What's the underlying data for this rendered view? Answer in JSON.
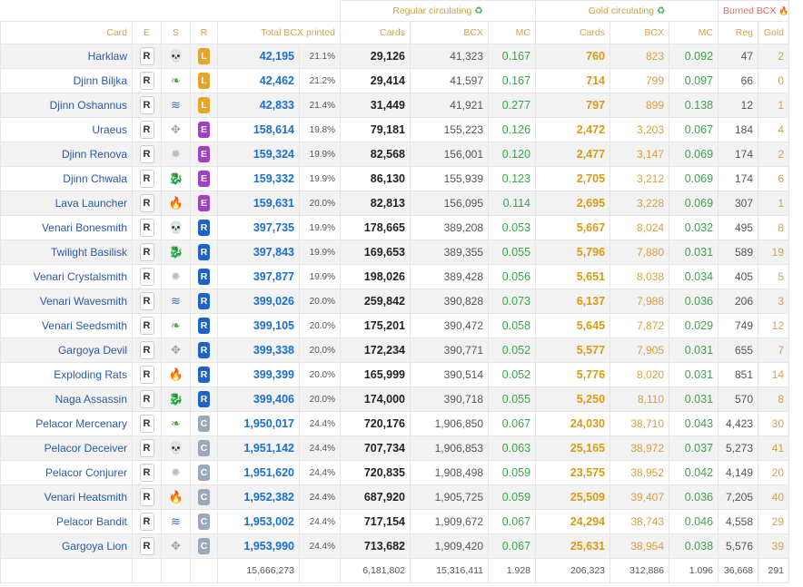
{
  "headers": {
    "group_regular": "Regular circulating",
    "group_gold": "Gold circulating",
    "group_burned": "Burned BCX",
    "col_card": "Card",
    "col_e": "E",
    "col_s": "S",
    "col_r": "R",
    "col_total": "Total BCX printed",
    "col_reg_cards": "Cards",
    "col_reg_bcx": "BCX",
    "col_reg_mc": "MC",
    "col_gold_cards": "Cards",
    "col_gold_bcx": "BCX",
    "col_gold_mc": "MC",
    "col_burn_reg": "Reg",
    "col_burn_gold": "Gold"
  },
  "icons": {
    "recycle": "♻",
    "fire": "🔥"
  },
  "colors": {
    "legendary": "#e5a52a",
    "epic": "#a23fc4",
    "rare": "#1e64c8",
    "common": "#9aa8b8",
    "death": "#8a2fa0",
    "earth": "#4ea63a",
    "water": "#3b6fc7",
    "neutral": "#9aa3ad",
    "life": "#bfbfbf",
    "dragon": "#e2a41c",
    "fire": "#d8331f"
  },
  "element_glyphs": {
    "death": "💀",
    "earth": "❧",
    "water": "≋",
    "neutral": "✥",
    "life": "✹",
    "dragon": "🐉",
    "fire": "🔥"
  },
  "rows": [
    {
      "card": "Harklaw",
      "edition": "R",
      "element": "death",
      "rarity": "L",
      "total": "42,195",
      "pct": "21.1%",
      "reg_cards": "29,126",
      "reg_bcx": "41,323",
      "reg_mc": "0.167",
      "gold_cards": "760",
      "gold_bcx": "823",
      "gold_mc": "0.092",
      "burn_reg": "47",
      "burn_gold": "2"
    },
    {
      "card": "Djinn Biljka",
      "edition": "R",
      "element": "earth",
      "rarity": "L",
      "total": "42,462",
      "pct": "21.2%",
      "reg_cards": "29,414",
      "reg_bcx": "41,597",
      "reg_mc": "0.167",
      "gold_cards": "714",
      "gold_bcx": "799",
      "gold_mc": "0.097",
      "burn_reg": "66",
      "burn_gold": "0"
    },
    {
      "card": "Djinn Oshannus",
      "edition": "R",
      "element": "water",
      "rarity": "L",
      "total": "42,833",
      "pct": "21.4%",
      "reg_cards": "31,449",
      "reg_bcx": "41,921",
      "reg_mc": "0.277",
      "gold_cards": "797",
      "gold_bcx": "899",
      "gold_mc": "0.138",
      "burn_reg": "12",
      "burn_gold": "1"
    },
    {
      "card": "Uraeus",
      "edition": "R",
      "element": "neutral",
      "rarity": "E",
      "total": "158,614",
      "pct": "19.8%",
      "reg_cards": "79,181",
      "reg_bcx": "155,223",
      "reg_mc": "0.126",
      "gold_cards": "2,472",
      "gold_bcx": "3,203",
      "gold_mc": "0.067",
      "burn_reg": "184",
      "burn_gold": "4"
    },
    {
      "card": "Djinn Renova",
      "edition": "R",
      "element": "life",
      "rarity": "E",
      "total": "159,324",
      "pct": "19.9%",
      "reg_cards": "82,568",
      "reg_bcx": "156,001",
      "reg_mc": "0.120",
      "gold_cards": "2,477",
      "gold_bcx": "3,147",
      "gold_mc": "0.069",
      "burn_reg": "174",
      "burn_gold": "2"
    },
    {
      "card": "Djinn Chwala",
      "edition": "R",
      "element": "dragon",
      "rarity": "E",
      "total": "159,332",
      "pct": "19.9%",
      "reg_cards": "86,130",
      "reg_bcx": "155,939",
      "reg_mc": "0.123",
      "gold_cards": "2,705",
      "gold_bcx": "3,212",
      "gold_mc": "0.069",
      "burn_reg": "174",
      "burn_gold": "6"
    },
    {
      "card": "Lava Launcher",
      "edition": "R",
      "element": "fire",
      "rarity": "E",
      "total": "159,631",
      "pct": "20.0%",
      "reg_cards": "82,813",
      "reg_bcx": "156,095",
      "reg_mc": "0.114",
      "gold_cards": "2,695",
      "gold_bcx": "3,228",
      "gold_mc": "0.069",
      "burn_reg": "307",
      "burn_gold": "1"
    },
    {
      "card": "Venari Bonesmith",
      "edition": "R",
      "element": "death",
      "rarity": "R",
      "total": "397,735",
      "pct": "19.9%",
      "reg_cards": "178,665",
      "reg_bcx": "389,208",
      "reg_mc": "0.053",
      "gold_cards": "5,667",
      "gold_bcx": "8,024",
      "gold_mc": "0.032",
      "burn_reg": "495",
      "burn_gold": "8"
    },
    {
      "card": "Twilight Basilisk",
      "edition": "R",
      "element": "dragon",
      "rarity": "R",
      "total": "397,843",
      "pct": "19.9%",
      "reg_cards": "169,653",
      "reg_bcx": "389,355",
      "reg_mc": "0.055",
      "gold_cards": "5,796",
      "gold_bcx": "7,880",
      "gold_mc": "0.031",
      "burn_reg": "589",
      "burn_gold": "19"
    },
    {
      "card": "Venari Crystalsmith",
      "edition": "R",
      "element": "life",
      "rarity": "R",
      "total": "397,877",
      "pct": "19.9%",
      "reg_cards": "198,026",
      "reg_bcx": "389,428",
      "reg_mc": "0.056",
      "gold_cards": "5,651",
      "gold_bcx": "8,038",
      "gold_mc": "0.034",
      "burn_reg": "405",
      "burn_gold": "5"
    },
    {
      "card": "Venari Wavesmith",
      "edition": "R",
      "element": "water",
      "rarity": "R",
      "total": "399,026",
      "pct": "20.0%",
      "reg_cards": "259,842",
      "reg_bcx": "390,828",
      "reg_mc": "0.073",
      "gold_cards": "6,137",
      "gold_bcx": "7,988",
      "gold_mc": "0.036",
      "burn_reg": "206",
      "burn_gold": "3"
    },
    {
      "card": "Venari Seedsmith",
      "edition": "R",
      "element": "earth",
      "rarity": "R",
      "total": "399,105",
      "pct": "20.0%",
      "reg_cards": "175,201",
      "reg_bcx": "390,472",
      "reg_mc": "0.058",
      "gold_cards": "5,645",
      "gold_bcx": "7,872",
      "gold_mc": "0.029",
      "burn_reg": "749",
      "burn_gold": "12"
    },
    {
      "card": "Gargoya Devil",
      "edition": "R",
      "element": "neutral",
      "rarity": "R",
      "total": "399,338",
      "pct": "20.0%",
      "reg_cards": "172,234",
      "reg_bcx": "390,771",
      "reg_mc": "0.052",
      "gold_cards": "5,577",
      "gold_bcx": "7,905",
      "gold_mc": "0.031",
      "burn_reg": "655",
      "burn_gold": "7"
    },
    {
      "card": "Exploding Rats",
      "edition": "R",
      "element": "fire",
      "rarity": "R",
      "total": "399,399",
      "pct": "20.0%",
      "reg_cards": "165,999",
      "reg_bcx": "390,514",
      "reg_mc": "0.052",
      "gold_cards": "5,776",
      "gold_bcx": "8,020",
      "gold_mc": "0.031",
      "burn_reg": "851",
      "burn_gold": "14"
    },
    {
      "card": "Naga Assassin",
      "edition": "R",
      "element": "dragon",
      "rarity": "R",
      "total": "399,406",
      "pct": "20.0%",
      "reg_cards": "174,000",
      "reg_bcx": "390,718",
      "reg_mc": "0.055",
      "gold_cards": "5,250",
      "gold_bcx": "8,110",
      "gold_mc": "0.031",
      "burn_reg": "570",
      "burn_gold": "8"
    },
    {
      "card": "Pelacor Mercenary",
      "edition": "R",
      "element": "earth",
      "rarity": "C",
      "total": "1,950,017",
      "pct": "24.4%",
      "reg_cards": "720,176",
      "reg_bcx": "1,906,850",
      "reg_mc": "0.067",
      "gold_cards": "24,030",
      "gold_bcx": "38,710",
      "gold_mc": "0.043",
      "burn_reg": "4,423",
      "burn_gold": "30"
    },
    {
      "card": "Pelacor Deceiver",
      "edition": "R",
      "element": "death",
      "rarity": "C",
      "total": "1,951,142",
      "pct": "24.4%",
      "reg_cards": "707,734",
      "reg_bcx": "1,906,853",
      "reg_mc": "0.063",
      "gold_cards": "25,165",
      "gold_bcx": "38,972",
      "gold_mc": "0.037",
      "burn_reg": "5,273",
      "burn_gold": "41"
    },
    {
      "card": "Pelacor Conjurer",
      "edition": "R",
      "element": "life",
      "rarity": "C",
      "total": "1,951,620",
      "pct": "24.4%",
      "reg_cards": "720,835",
      "reg_bcx": "1,908,498",
      "reg_mc": "0.059",
      "gold_cards": "23,575",
      "gold_bcx": "38,952",
      "gold_mc": "0.042",
      "burn_reg": "4,149",
      "burn_gold": "20"
    },
    {
      "card": "Venari Heatsmith",
      "edition": "R",
      "element": "fire",
      "rarity": "C",
      "total": "1,952,382",
      "pct": "24.4%",
      "reg_cards": "687,920",
      "reg_bcx": "1,905,725",
      "reg_mc": "0.059",
      "gold_cards": "25,509",
      "gold_bcx": "39,407",
      "gold_mc": "0.036",
      "burn_reg": "7,205",
      "burn_gold": "40"
    },
    {
      "card": "Pelacor Bandit",
      "edition": "R",
      "element": "water",
      "rarity": "C",
      "total": "1,953,002",
      "pct": "24.4%",
      "reg_cards": "717,154",
      "reg_bcx": "1,909,672",
      "reg_mc": "0.067",
      "gold_cards": "24,294",
      "gold_bcx": "38,743",
      "gold_mc": "0.046",
      "burn_reg": "4,558",
      "burn_gold": "29"
    },
    {
      "card": "Gargoya Lion",
      "edition": "R",
      "element": "neutral",
      "rarity": "C",
      "total": "1,953,990",
      "pct": "24.4%",
      "reg_cards": "713,682",
      "reg_bcx": "1,909,420",
      "reg_mc": "0.067",
      "gold_cards": "25,631",
      "gold_bcx": "38,954",
      "gold_mc": "0.038",
      "burn_reg": "5,576",
      "burn_gold": "39"
    }
  ],
  "totals": {
    "total": "15,666,273",
    "reg_cards": "6,181,802",
    "reg_bcx": "15,316,411",
    "reg_mc": "1.928",
    "gold_cards": "206,323",
    "gold_bcx": "312,886",
    "gold_mc": "1.096",
    "burn_reg": "36,668",
    "burn_gold": "291"
  }
}
